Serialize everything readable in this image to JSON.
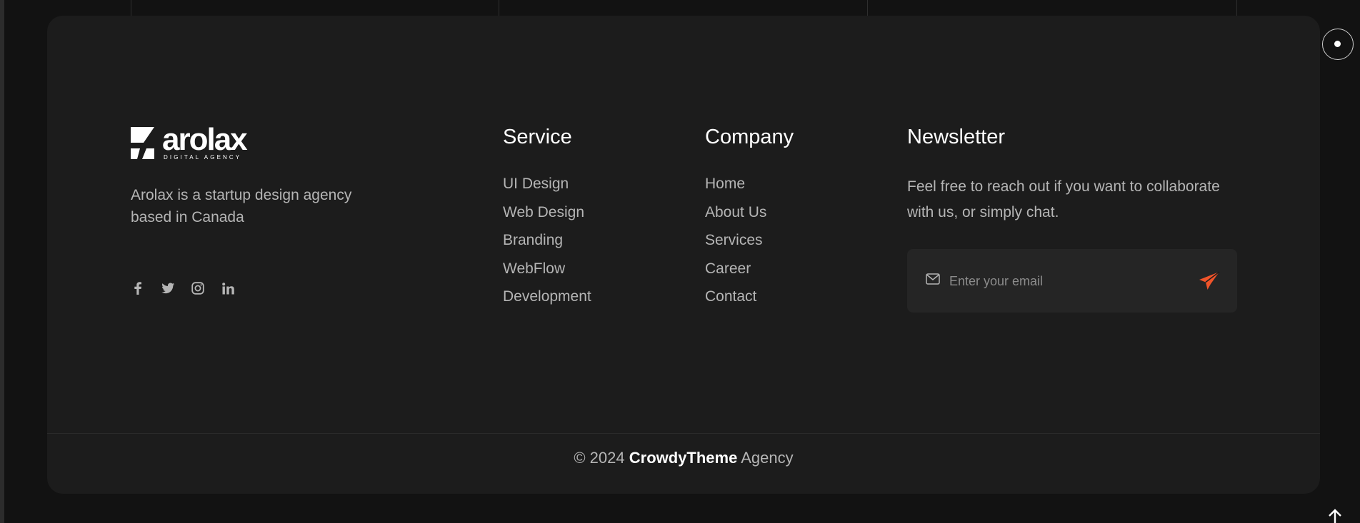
{
  "brand": {
    "name": "arolax",
    "subtitle": "DIGITAL AGENCY",
    "tagline": "Arolax is a startup design agency based in Canada"
  },
  "socials": [
    "facebook-icon",
    "twitter-icon",
    "instagram-icon",
    "linkedin-icon"
  ],
  "service": {
    "title": "Service",
    "links": [
      "UI Design",
      "Web Design",
      "Branding",
      "WebFlow",
      "Development"
    ]
  },
  "company": {
    "title": "Company",
    "links": [
      "Home",
      "About Us",
      "Services",
      "Career",
      "Contact"
    ]
  },
  "newsletter": {
    "title": "Newsletter",
    "text": "Feel free to reach out if you want to collaborate with us, or simply chat.",
    "placeholder": "Enter your email",
    "email_value": ""
  },
  "copyright": {
    "prefix": "© 2024",
    "brand": "CrowdyTheme",
    "suffix": "Agency"
  },
  "colors": {
    "background": "#121212",
    "card": "#1c1c1c",
    "accent": "#f0542a",
    "text": "#b5b5b5",
    "heading": "#ffffff"
  }
}
